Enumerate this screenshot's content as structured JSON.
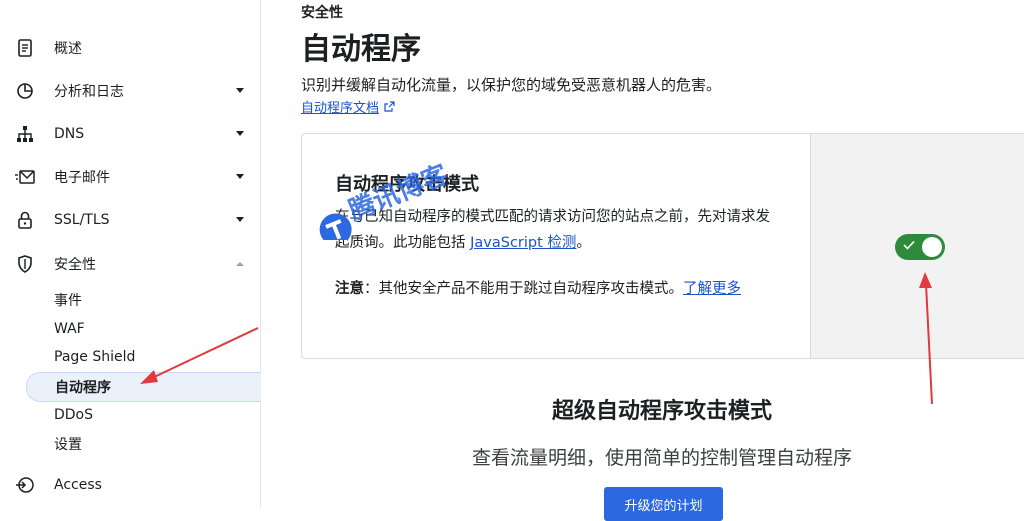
{
  "sidebar": {
    "items": [
      {
        "label": "概述",
        "icon": "document-icon"
      },
      {
        "label": "分析和日志",
        "icon": "chart-icon"
      },
      {
        "label": "DNS",
        "icon": "network-icon"
      },
      {
        "label": "电子邮件",
        "icon": "email-icon"
      },
      {
        "label": "SSL/TLS",
        "icon": "lock-icon"
      },
      {
        "label": "安全性",
        "icon": "shield-icon"
      }
    ],
    "security_sub": [
      "事件",
      "WAF",
      "Page Shield",
      "自动程序",
      "DDoS",
      "设置"
    ],
    "access": {
      "label": "Access",
      "icon": "access-icon"
    }
  },
  "main": {
    "kicker": "安全性",
    "title": "自动程序",
    "description": "识别并缓解自动化流量，以保护您的域免受恶意机器人的危害。",
    "doc_link": "自动程序文档",
    "card": {
      "title": "自动程序攻击模式",
      "text": "在与已知自动程序的模式匹配的请求访问您的站点之前，先对请求发起质询。此功能包括 ",
      "text_link": "JavaScript 检测",
      "text_end": "。",
      "note_label": "注意",
      "note_text": "：其他安全产品不能用于跳过自动程序攻击模式。",
      "note_link": "了解更多",
      "toggle_state": "on"
    },
    "super": {
      "title": "超级自动程序攻击模式",
      "description": "查看流量明细，使用简单的控制管理自动程序",
      "button": "升级您的计划"
    }
  },
  "watermark": "腾讯博客",
  "colors": {
    "accent": "#2c68e0",
    "toggle_on": "#2e8b3c",
    "link": "#1a52c9",
    "arrow": "#e0393e"
  }
}
